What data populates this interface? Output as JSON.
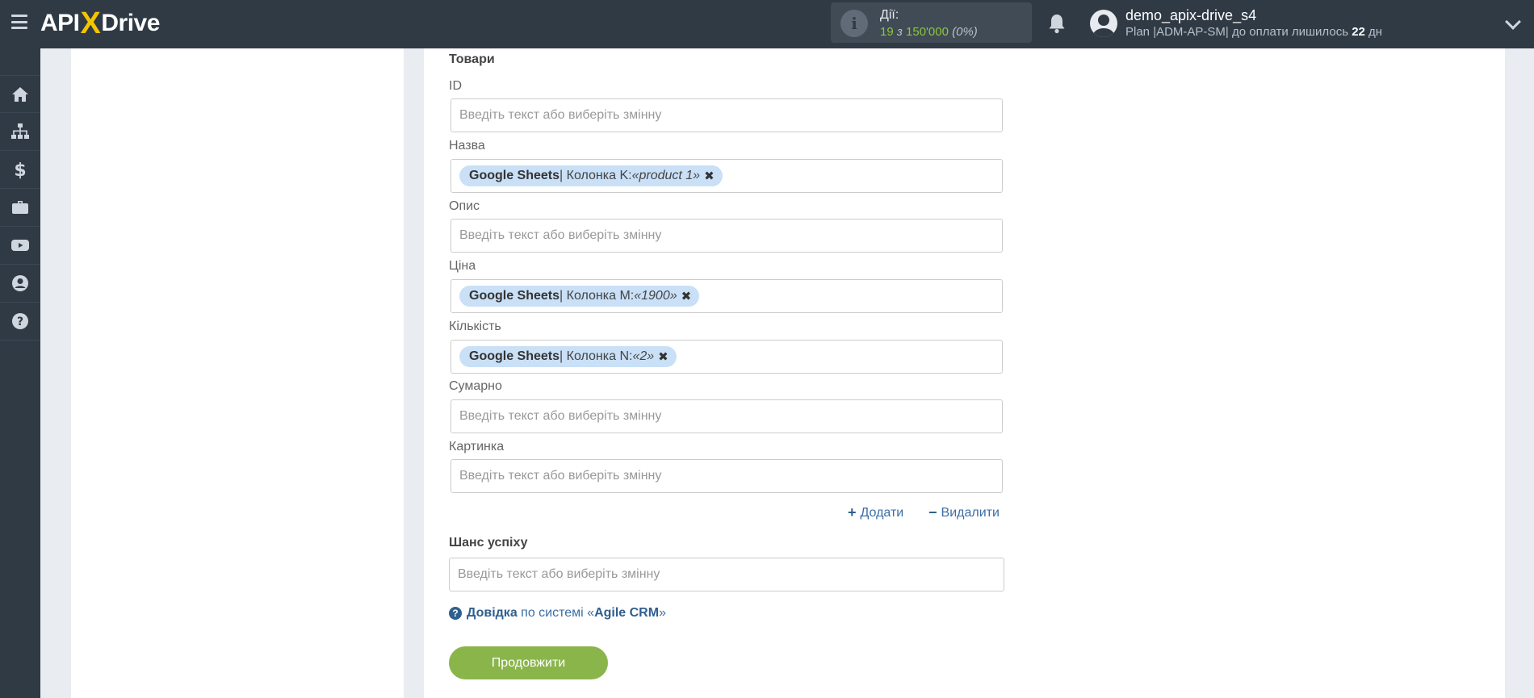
{
  "header": {
    "logo_left": "API",
    "logo_x": "X",
    "logo_right": "Drive",
    "actions_label": "Дії:",
    "actions_used": "19",
    "actions_of": "з",
    "actions_total": "150'000",
    "actions_percent": "(0%)",
    "username": "demo_apix-drive_s4",
    "plan_prefix": "Plan |ADM-AP-SM| до оплати лишилось",
    "plan_days": "22",
    "plan_suffix": "дн"
  },
  "sidebar": {
    "items": [
      {
        "name": "home-icon"
      },
      {
        "name": "sitemap-icon"
      },
      {
        "name": "dollar-icon"
      },
      {
        "name": "briefcase-icon"
      },
      {
        "name": "youtube-icon"
      },
      {
        "name": "user-icon"
      },
      {
        "name": "help-icon"
      }
    ]
  },
  "form": {
    "section_title": "Товари",
    "placeholder": "Введіть текст або виберіть змінну",
    "fields": {
      "id": {
        "label": "ID"
      },
      "name": {
        "label": "Назва",
        "chip_source": "Google Sheets",
        "chip_column": " | Колонка K: ",
        "chip_value": "«product 1»"
      },
      "description": {
        "label": "Опис"
      },
      "price": {
        "label": "Ціна",
        "chip_source": "Google Sheets",
        "chip_column": " | Колонка M: ",
        "chip_value": "«1900»"
      },
      "quantity": {
        "label": "Кількість",
        "chip_source": "Google Sheets",
        "chip_column": " | Колонка N: ",
        "chip_value": "«2»"
      },
      "total": {
        "label": "Сумарно"
      },
      "image": {
        "label": "Картинка"
      }
    },
    "add_label": "Додати",
    "remove_label": "Видалити",
    "success_title": "Шанс успіху",
    "help_prefix": "Довідка",
    "help_middle": " по системі «",
    "help_system": "Agile CRM",
    "help_suffix": "»",
    "continue_label": "Продовжити"
  },
  "colors": {
    "topbar": "#2f3a45",
    "accent_green": "#8ab54a",
    "chip_bg": "#c9e0f7",
    "link_blue": "#3b6ea5"
  }
}
